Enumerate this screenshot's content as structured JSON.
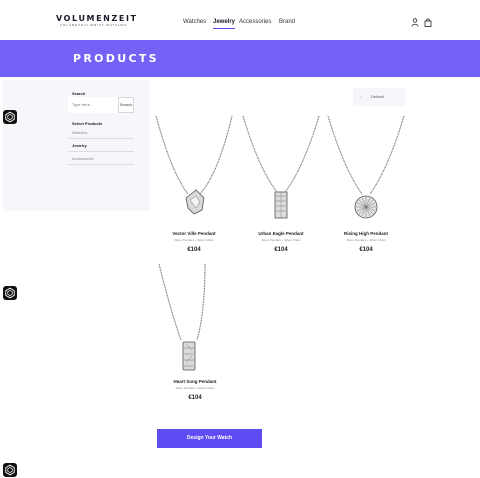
{
  "header": {
    "logo_main": "VOLUMENZEIT",
    "logo_sub": "VOLUMETRIC WRIST WATCHES",
    "nav": [
      {
        "label": "Watches",
        "active": false
      },
      {
        "label": "Jewelry",
        "active": true
      },
      {
        "label": "Accessories",
        "active": false
      },
      {
        "label": "Brand",
        "active": false
      }
    ],
    "icons": [
      "user-icon",
      "shopping-bag-icon"
    ]
  },
  "hero": {
    "title": "PRODUCTS",
    "color": "#7462f6"
  },
  "sidebar": {
    "search_label": "Search",
    "search_placeholder": "Type here...",
    "search_button": "Search",
    "section_label": "Select Products",
    "links": [
      "Watches",
      "Jewelry",
      "Accessories"
    ]
  },
  "sort": {
    "arrow": "←",
    "label": "Default"
  },
  "products": [
    {
      "name": "Vector Ville Pendant",
      "desc": "Silver Pendant + Silver Chain",
      "price": "€104"
    },
    {
      "name": "Urban Eagle Pendant",
      "desc": "Silver Pendant + Silver Chain",
      "price": "€104"
    },
    {
      "name": "Rising High Pendant",
      "desc": "Silver Pendant + Silver Chain",
      "price": "€104"
    },
    {
      "name": "Heart Song Pendant",
      "desc": "Silver Pendant + Silver Chain",
      "price": "€104"
    }
  ],
  "cta": {
    "label": "Design Your Watch",
    "color": "#5f4cf2"
  }
}
